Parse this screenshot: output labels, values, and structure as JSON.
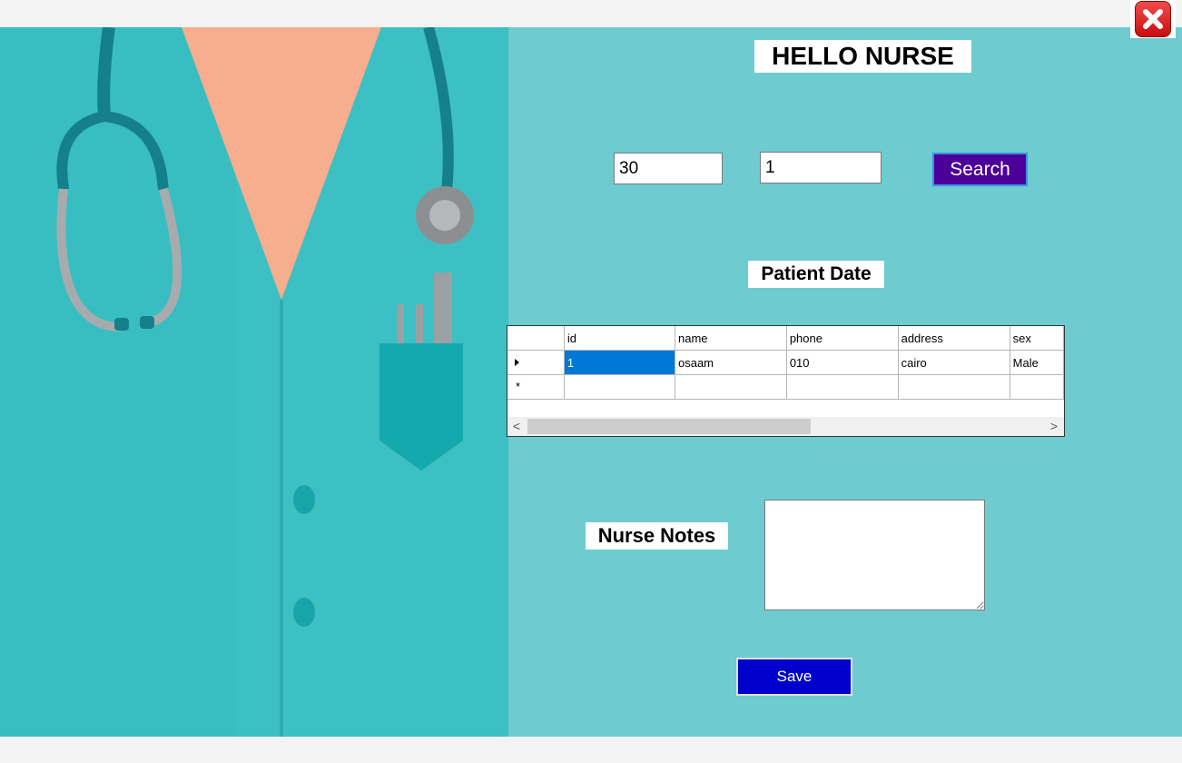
{
  "window": {
    "close_label": "Close"
  },
  "header": {
    "title": "HELLO NURSE"
  },
  "search": {
    "field1_value": "30",
    "field2_value": "1",
    "button_label": "Search"
  },
  "patient_section": {
    "title": "Patient Date"
  },
  "grid": {
    "columns": [
      "id",
      "name",
      "phone",
      "address",
      "sex"
    ],
    "rows": [
      [
        "1",
        "osaam",
        "010",
        "cairo",
        "Male"
      ]
    ],
    "scroll_left": "<",
    "scroll_right": ">"
  },
  "notes": {
    "label": "Nurse Notes",
    "value": ""
  },
  "save": {
    "button_label": "Save"
  },
  "colors": {
    "background": "#6ecbcf",
    "search_button": "#4d0099",
    "save_button": "#0000cc",
    "selection": "#0078d7"
  }
}
